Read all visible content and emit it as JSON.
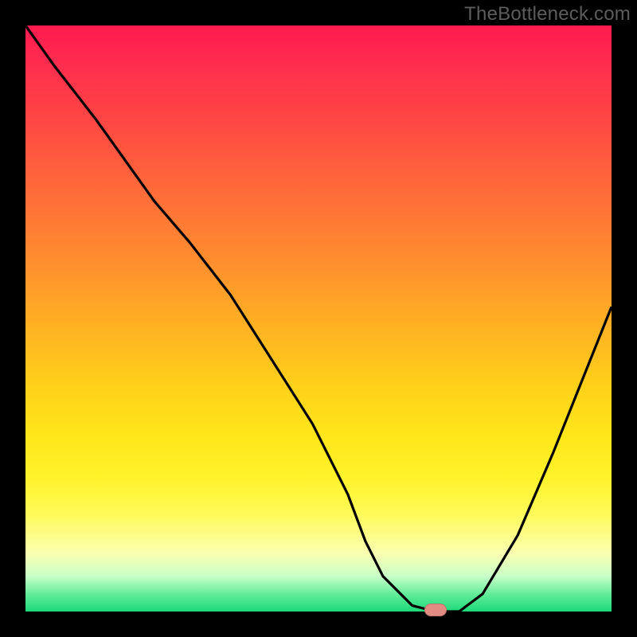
{
  "watermark": "TheBottleneck.com",
  "chart_data": {
    "type": "line",
    "title": "",
    "xlabel": "",
    "ylabel": "",
    "xlim": [
      0,
      100
    ],
    "ylim": [
      0,
      100
    ],
    "grid": false,
    "x": [
      0,
      5,
      12,
      22,
      28,
      35,
      42,
      49,
      55,
      58,
      61,
      66,
      70,
      74,
      78,
      84,
      90,
      100
    ],
    "values": [
      100,
      93,
      84,
      70,
      63,
      54,
      43,
      32,
      20,
      12,
      6,
      1,
      0,
      0,
      3,
      13,
      27,
      52
    ],
    "marker": {
      "x": 70,
      "y": 0
    },
    "description": "V-shaped bottleneck curve on red-to-green vertical gradient; minimum (optimal) near x≈70%."
  },
  "colors": {
    "curve": "#000000",
    "marker": "#e28b82",
    "frame": "#000000"
  }
}
